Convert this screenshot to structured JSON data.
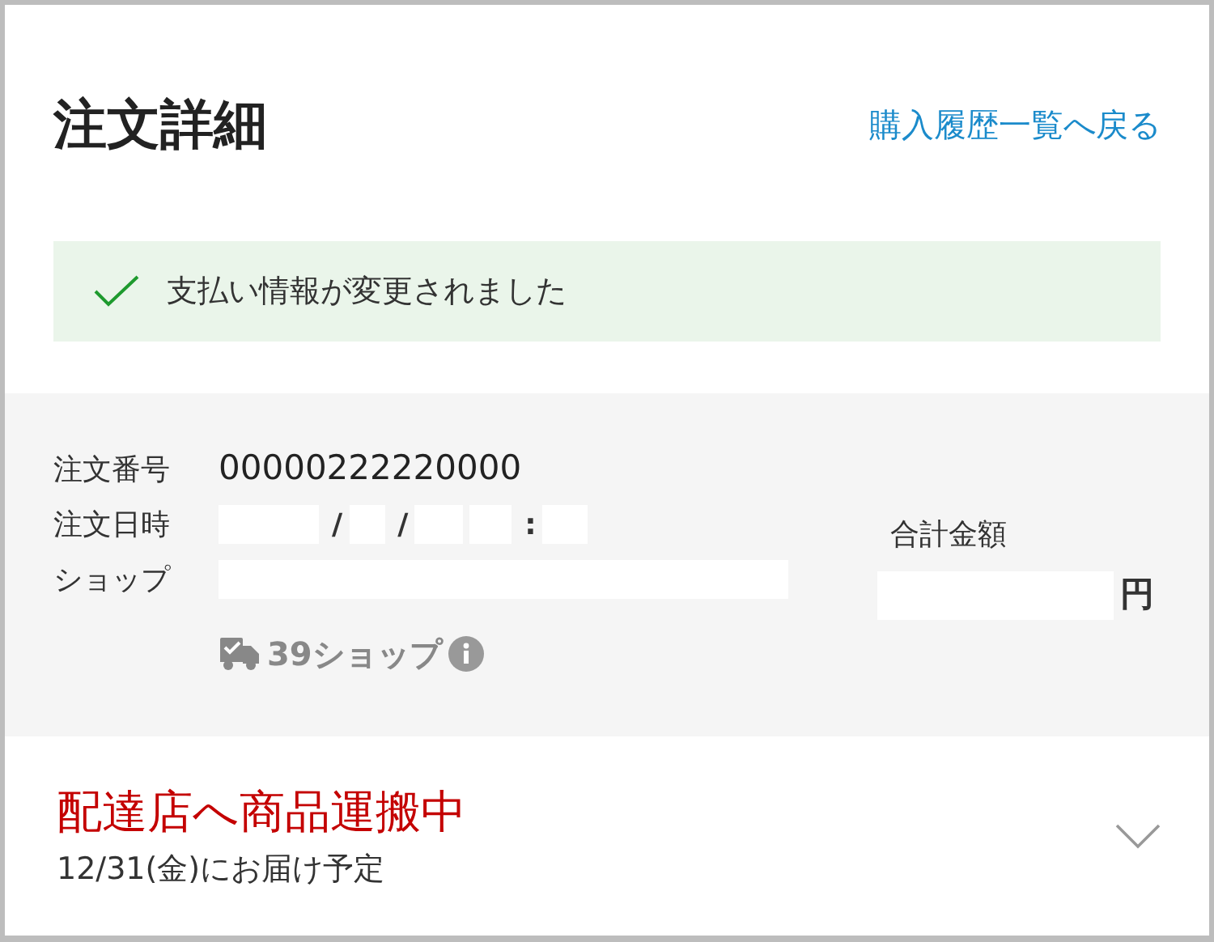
{
  "page_title": "注文詳細",
  "back_link": "購入履歴一覧へ戻る",
  "notice": {
    "kind": "success",
    "text": "支払い情報が変更されました"
  },
  "order": {
    "fields": [
      {
        "label": "注文番号",
        "parts": [
          {
            "kind": "text",
            "text": "00000222220000"
          }
        ]
      },
      {
        "label": "注文日時",
        "parts": [
          {
            "kind": "blank"
          },
          {
            "kind": "text",
            "text": "/"
          },
          {
            "kind": "blank"
          },
          {
            "kind": "text",
            "text": "/"
          },
          {
            "kind": "blank"
          },
          {
            "kind": "blank"
          },
          {
            "kind": "text",
            "text": ":"
          },
          {
            "kind": "blank"
          }
        ]
      },
      {
        "label": "ショップ",
        "parts": [
          {
            "kind": "blank"
          }
        ]
      }
    ],
    "shop_badge": "39ショップ",
    "total_label": "合計金額",
    "total_unit": "円"
  },
  "delivery": {
    "status": "配達店へ商品運搬中",
    "date": "12/31(金)にお届け予定",
    "expanded": false
  }
}
